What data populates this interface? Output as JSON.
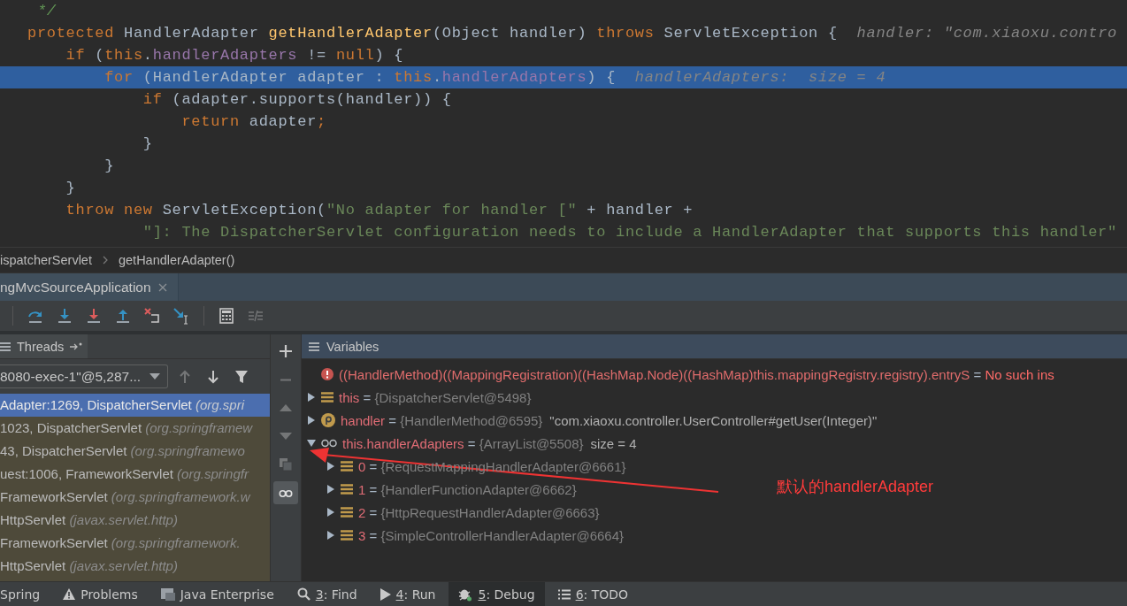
{
  "editor": {
    "lines": [
      {
        "highlighted": false,
        "tokens": [
          {
            "kind": "comment",
            "text": " */"
          }
        ]
      },
      {
        "highlighted": false,
        "tokens": [
          {
            "kind": "kw",
            "text": "protected "
          },
          {
            "kind": "plain",
            "text": "HandlerAdapter "
          },
          {
            "kind": "method",
            "text": "getHandlerAdapter"
          },
          {
            "kind": "plain",
            "text": "(Object handler) "
          },
          {
            "kind": "kw",
            "text": "throws "
          },
          {
            "kind": "plain",
            "text": "ServletException {  "
          },
          {
            "kind": "hint",
            "text": "handler: \"com.xiaoxu.contro"
          }
        ]
      },
      {
        "highlighted": false,
        "tokens": [
          {
            "kind": "kw",
            "text": "    if "
          },
          {
            "kind": "plain",
            "text": "("
          },
          {
            "kind": "kw",
            "text": "this"
          },
          {
            "kind": "plain",
            "text": "."
          },
          {
            "kind": "field",
            "text": "handlerAdapters"
          },
          {
            "kind": "plain",
            "text": " != "
          },
          {
            "kind": "kw",
            "text": "null"
          },
          {
            "kind": "plain",
            "text": ") {"
          }
        ]
      },
      {
        "highlighted": true,
        "tokens": [
          {
            "kind": "kw",
            "text": "        for "
          },
          {
            "kind": "plain",
            "text": "(HandlerAdapter adapter : "
          },
          {
            "kind": "kw",
            "text": "this"
          },
          {
            "kind": "plain",
            "text": "."
          },
          {
            "kind": "field",
            "text": "handlerAdapters"
          },
          {
            "kind": "plain",
            "text": ") {  "
          },
          {
            "kind": "hint",
            "text": "handlerAdapters:  size = 4"
          }
        ]
      },
      {
        "highlighted": false,
        "tokens": [
          {
            "kind": "kw",
            "text": "            if "
          },
          {
            "kind": "plain",
            "text": "(adapter.supports(handler)) {"
          }
        ]
      },
      {
        "highlighted": false,
        "tokens": [
          {
            "kind": "kw",
            "text": "                return "
          },
          {
            "kind": "plain",
            "text": "adapter"
          },
          {
            "kind": "kw",
            "text": ";"
          }
        ]
      },
      {
        "highlighted": false,
        "tokens": [
          {
            "kind": "plain",
            "text": "            }"
          }
        ]
      },
      {
        "highlighted": false,
        "tokens": [
          {
            "kind": "plain",
            "text": "        }"
          }
        ]
      },
      {
        "highlighted": false,
        "tokens": [
          {
            "kind": "plain",
            "text": "    }"
          }
        ]
      },
      {
        "highlighted": false,
        "tokens": [
          {
            "kind": "kw",
            "text": "    throw new "
          },
          {
            "kind": "plain",
            "text": "ServletException("
          },
          {
            "kind": "string",
            "text": "\"No adapter for handler [\""
          },
          {
            "kind": "plain",
            "text": " + handler +"
          }
        ]
      },
      {
        "highlighted": false,
        "tokens": [
          {
            "kind": "string",
            "text": "            \"]: The DispatcherServlet configuration needs to include a HandlerAdapter that supports this handler\""
          }
        ]
      }
    ]
  },
  "breadcrumb": [
    "ispatcherServlet",
    "getHandlerAdapter()"
  ],
  "session_tab": {
    "label": "ngMvcSourceApplication"
  },
  "toolbar": [
    {
      "kind": "step-over",
      "disabled": false
    },
    {
      "kind": "step-into",
      "disabled": false
    },
    {
      "kind": "force-step-into",
      "disabled": false
    },
    {
      "kind": "step-out",
      "disabled": false
    },
    {
      "kind": "drop-frame",
      "disabled": false
    },
    {
      "kind": "run-to-cursor",
      "disabled": false
    },
    {
      "kind": "evaluate",
      "disabled": false
    },
    {
      "kind": "trace",
      "disabled": true
    }
  ],
  "threads_panel": {
    "title": "Threads",
    "thread": "8080-exec-1\"@5,287...",
    "nav": [
      {
        "kind": "up",
        "disabled": true
      },
      {
        "kind": "down",
        "disabled": false
      },
      {
        "kind": "filter",
        "disabled": false
      }
    ],
    "frames": [
      {
        "method": "Adapter:1269, DispatcherServlet",
        "package": "(org.spri",
        "selected": true
      },
      {
        "method": "1023, DispatcherServlet",
        "package": "(org.springframew",
        "selected": false
      },
      {
        "method": "43, DispatcherServlet",
        "package": "(org.springframewo",
        "selected": false
      },
      {
        "method": "uest:1006, FrameworkServlet",
        "package": "(org.springfr",
        "selected": false
      },
      {
        "method": "FrameworkServlet",
        "package": "(org.springframework.w",
        "selected": false
      },
      {
        "method": "HttpServlet",
        "package": "(javax.servlet.http)",
        "selected": false
      },
      {
        "method": "FrameworkServlet",
        "package": "(org.springframework.",
        "selected": false
      },
      {
        "method": "HttpServlet",
        "package": "(javax.servlet.http)",
        "selected": false
      }
    ]
  },
  "side_toolbar": [
    {
      "kind": "add",
      "disabled": false,
      "selected": false
    },
    {
      "kind": "remove",
      "disabled": true,
      "selected": false
    },
    {
      "kind": "up",
      "disabled": true,
      "selected": false
    },
    {
      "kind": "down",
      "disabled": true,
      "selected": false
    },
    {
      "kind": "copy",
      "disabled": true,
      "selected": false
    },
    {
      "kind": "watches",
      "disabled": false,
      "selected": true
    }
  ],
  "variables_panel": {
    "title": "Variables",
    "variables": [
      {
        "kind": "error",
        "sign": "=",
        "name": "((HandlerMethod)((MappingRegistration)((HashMap.Node)((HashMap)this.mappingRegistry.registry).entryS",
        "value": "No such ins"
      },
      {
        "kind": "field",
        "sign": "=",
        "expanded": false,
        "name": "this",
        "value": "{DispatcherServlet@5498}"
      },
      {
        "kind": "param",
        "sign": "=",
        "expanded": false,
        "name": "handler",
        "value": "{HandlerMethod@6595}",
        "extra": "\"com.xiaoxu.controller.UserController#getUser(Integer)\""
      },
      {
        "kind": "watch",
        "sign": "=",
        "expanded": true,
        "name": "this.handlerAdapters",
        "value": "{ArrayList@5508}",
        "extra": "size = 4",
        "children": [
          {
            "kind": "field",
            "sign": "=",
            "expanded": false,
            "name": "0",
            "value": "{RequestMappingHandlerAdapter@6661}"
          },
          {
            "kind": "field",
            "sign": "=",
            "expanded": false,
            "name": "1",
            "value": "{HandlerFunctionAdapter@6662}"
          },
          {
            "kind": "field",
            "sign": "=",
            "expanded": false,
            "name": "2",
            "value": "{HttpRequestHandlerAdapter@6663}"
          },
          {
            "kind": "field",
            "sign": "=",
            "expanded": false,
            "name": "3",
            "value": "{SimpleControllerHandlerAdapter@6664}"
          }
        ]
      }
    ]
  },
  "annotation": {
    "text": "默认的handlerAdapter"
  },
  "bottom_tabs": [
    {
      "kind": "spring",
      "label": "Spring",
      "selected": false
    },
    {
      "kind": "problems",
      "label": "Problems",
      "selected": false
    },
    {
      "kind": "enterprise",
      "label": "Java Enterprise",
      "selected": false
    },
    {
      "kind": "find",
      "mnemonic": "3",
      "label": ": Find",
      "selected": false
    },
    {
      "kind": "run",
      "mnemonic": "4",
      "label": ": Run",
      "selected": false
    },
    {
      "kind": "debug",
      "mnemonic": "5",
      "label": ": Debug",
      "selected": true
    },
    {
      "kind": "todo",
      "mnemonic": "6",
      "label": ": TODO",
      "selected": false
    }
  ]
}
